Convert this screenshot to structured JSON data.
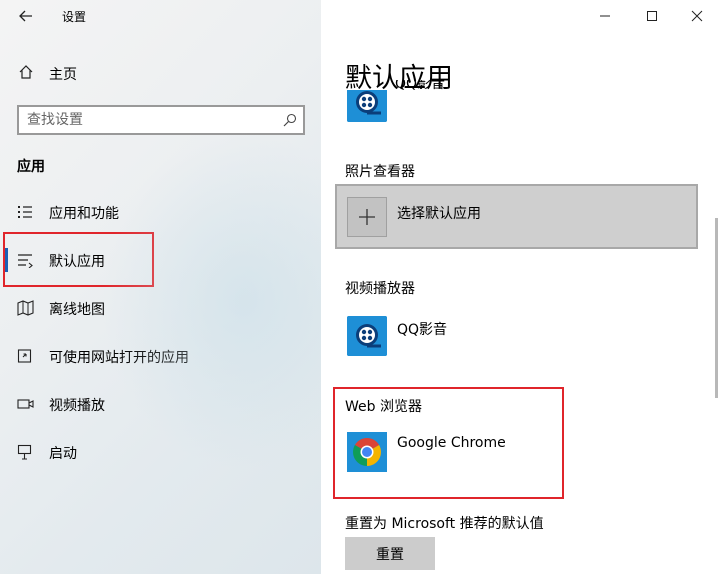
{
  "window": {
    "title": "设置",
    "controls": [
      "minimize",
      "maximize",
      "close"
    ]
  },
  "sidebar": {
    "home_label": "主页",
    "search_placeholder": "查找设置",
    "section_heading": "应用",
    "items": [
      {
        "label": "应用和功能",
        "icon": "apps-features-icon"
      },
      {
        "label": "默认应用",
        "icon": "default-apps-icon",
        "selected": true
      },
      {
        "label": "离线地图",
        "icon": "offline-maps-icon"
      },
      {
        "label": "可使用网站打开的应用",
        "icon": "apps-for-websites-icon"
      },
      {
        "label": "视频播放",
        "icon": "video-playback-icon"
      },
      {
        "label": "启动",
        "icon": "startup-icon"
      }
    ]
  },
  "main": {
    "page_title": "默认应用",
    "partial_app_label": "QQ影音",
    "photo_viewer": {
      "category": "照片查看器",
      "choose_label": "选择默认应用"
    },
    "video_player": {
      "category": "视频播放器",
      "app_label": "QQ影音"
    },
    "web_browser": {
      "category": "Web 浏览器",
      "app_label": "Google Chrome"
    },
    "reset": {
      "description": "重置为 Microsoft 推荐的默认值",
      "button_label": "重置"
    }
  },
  "colors": {
    "selection_accent": "#1a5fb4",
    "annotation_red": "#e0252b",
    "qq_blue": "#1e8fd6"
  }
}
